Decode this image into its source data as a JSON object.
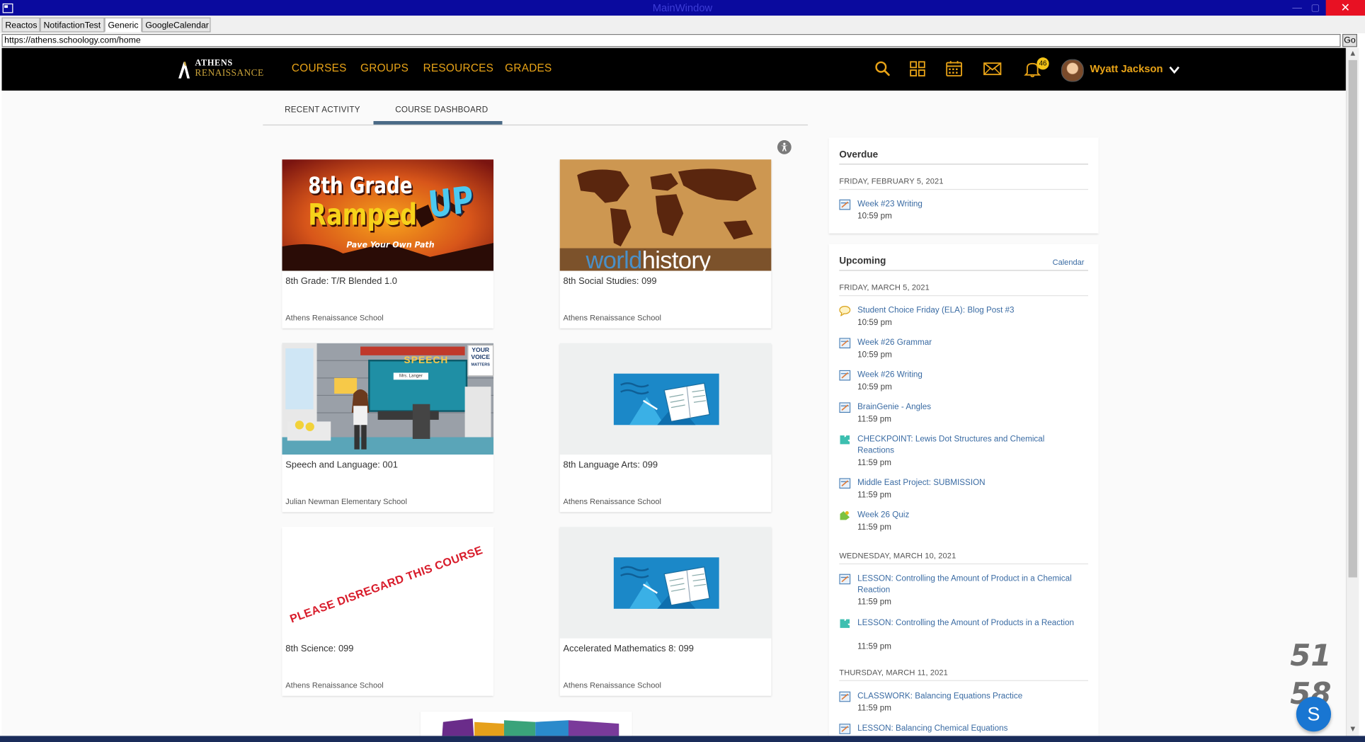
{
  "window": {
    "title": "MainWindow",
    "minimize": "—",
    "maximize": "▢",
    "close": "✕"
  },
  "tabs": [
    "Reactos",
    "NotifactionTest",
    "Generic",
    "GoogleCalendar"
  ],
  "url": {
    "value": "https://athens.schoology.com/home",
    "go": "Go"
  },
  "brand": {
    "line1": "ATHENS",
    "line2": "RENAISSANCE"
  },
  "nav": {
    "courses": "COURSES",
    "groups": "GROUPS",
    "resources": "RESOURCES",
    "grades": "GRADES"
  },
  "header": {
    "notifications_count": "46",
    "user_name": "Wyatt Jackson"
  },
  "subtabs": {
    "recent": "RECENT ACTIVITY",
    "dashboard": "COURSE DASHBOARD"
  },
  "courses": [
    {
      "name": "8th Grade: T/R Blended 1.0",
      "school": "Athens Renaissance School",
      "image_line1": "8th Grade",
      "image_line2": "Ramped",
      "image_line3": "UP",
      "image_tagline": "Pave Your Own Path"
    },
    {
      "name": "8th Social Studies: 099",
      "school": "Athens Renaissance School",
      "image_text": "worldhistory"
    },
    {
      "name": "Speech and Language: 001",
      "school": "Julian Newman Elementary School",
      "image_sign": "SPEECH",
      "image_badge1": "YOUR",
      "image_badge2": "VOICE",
      "image_badge3": "MATTERS",
      "image_board": "Mrs. Langer"
    },
    {
      "name": "8th Language Arts: 099",
      "school": "Athens Renaissance School"
    },
    {
      "name": "8th Science: 099",
      "school": "Athens Renaissance School",
      "image_text": "PLEASE DISREGARD THIS COURSE"
    },
    {
      "name": "Accelerated Mathematics 8: 099",
      "school": "Athens Renaissance School"
    }
  ],
  "overdue": {
    "title": "Overdue",
    "date": "FRIDAY, FEBRUARY 5, 2021",
    "items": [
      {
        "title": "Week #23 Writing",
        "time": "10:59 pm"
      }
    ]
  },
  "upcoming": {
    "title": "Upcoming",
    "calendar_link": "Calendar",
    "dates": [
      {
        "date": "FRIDAY, MARCH 5, 2021",
        "items": [
          {
            "title": "Student Choice Friday (ELA): Blog Post #3",
            "time": "10:59 pm",
            "icon": "discussion-icon"
          },
          {
            "title": "Week #26 Grammar",
            "time": "10:59 pm",
            "icon": "assignment-icon"
          },
          {
            "title": "Week #26 Writing",
            "time": "10:59 pm",
            "icon": "assignment-icon"
          },
          {
            "title": "BrainGenie - Angles",
            "time": "11:59 pm",
            "icon": "assignment-icon"
          },
          {
            "title": "CHECKPOINT: Lewis Dot Structures and Chemical Reactions",
            "time": "11:59 pm",
            "icon": "puzzle-icon"
          },
          {
            "title": "Middle East Project: SUBMISSION",
            "time": "11:59 pm",
            "icon": "assignment-icon"
          },
          {
            "title": "Week 26 Quiz",
            "time": "11:59 pm",
            "icon": "quiz-icon"
          }
        ]
      },
      {
        "date": "WEDNESDAY, MARCH 10, 2021",
        "items": [
          {
            "title": "LESSON: Controlling the Amount of Product in a Chemical Reaction",
            "time": "11:59 pm",
            "icon": "assignment-icon"
          },
          {
            "title": "LESSON: Controlling the Amount of Products in a Reaction",
            "time": "11:59 pm",
            "icon": "puzzle-icon"
          }
        ]
      },
      {
        "date": "THURSDAY, MARCH 11, 2021",
        "items": [
          {
            "title": "CLASSWORK: Balancing Equations Practice",
            "time": "11:59 pm",
            "icon": "assignment-icon"
          },
          {
            "title": "LESSON: Balancing Chemical Equations",
            "time": "",
            "icon": "assignment-icon"
          }
        ]
      }
    ]
  },
  "overlay": {
    "count_top": "51",
    "count_bottom": "58",
    "bubble": "S"
  },
  "colors": {
    "nav_gold": "#e8a317",
    "link_blue": "#3a6ba3",
    "titlebar": "#0a0a9e",
    "close_red": "#e81123"
  }
}
